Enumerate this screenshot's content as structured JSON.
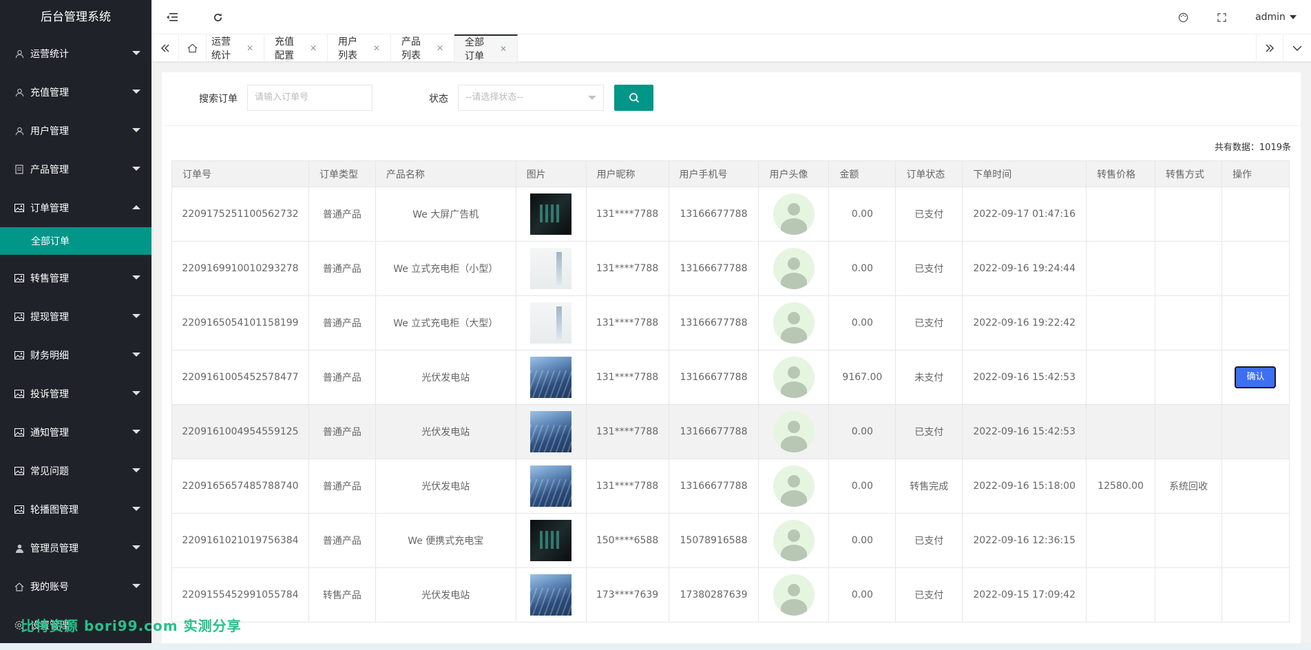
{
  "app": {
    "title": "后台管理系统",
    "user": "admin"
  },
  "sidebar": {
    "items": [
      {
        "label": "运营统计",
        "icon": "user-icon"
      },
      {
        "label": "充值管理",
        "icon": "user-icon"
      },
      {
        "label": "用户管理",
        "icon": "user-icon"
      },
      {
        "label": "产品管理",
        "icon": "doc-icon"
      },
      {
        "label": "订单管理",
        "icon": "image-icon",
        "expanded": true
      },
      {
        "label": "转售管理",
        "icon": "image-icon"
      },
      {
        "label": "提现管理",
        "icon": "image-icon"
      },
      {
        "label": "财务明细",
        "icon": "image-icon"
      },
      {
        "label": "投诉管理",
        "icon": "image-icon"
      },
      {
        "label": "通知管理",
        "icon": "image-icon"
      },
      {
        "label": "常见问题",
        "icon": "image-icon"
      },
      {
        "label": "轮播图管理",
        "icon": "image-icon"
      },
      {
        "label": "管理员管理",
        "icon": "person-icon"
      },
      {
        "label": "我的账号",
        "icon": "home-icon"
      },
      {
        "label": "设置管理",
        "icon": "gear-icon"
      }
    ],
    "sub_active": "全部订单"
  },
  "tabs": [
    {
      "label": "运营统计"
    },
    {
      "label": "充值配置"
    },
    {
      "label": "用户列表"
    },
    {
      "label": "产品列表"
    },
    {
      "label": "全部订单",
      "active": true
    }
  ],
  "search": {
    "order_label": "搜索订单",
    "order_placeholder": "请输入订单号",
    "status_label": "状态",
    "status_placeholder": "--请选择状态--"
  },
  "total": {
    "label": "共有数据：",
    "count": "1019条"
  },
  "table": {
    "headers": [
      "订单号",
      "订单类型",
      "产品名称",
      "图片",
      "用户昵称",
      "用户手机号",
      "用户头像",
      "金额",
      "订单状态",
      "下单时间",
      "转售价格",
      "转售方式",
      "操作"
    ],
    "rows": [
      {
        "order_no": "2209175251100562732",
        "type": "普通产品",
        "product": "We 大屏广告机",
        "image": "dark",
        "nickname": "131****7788",
        "phone": "13166677788",
        "amount": "0.00",
        "status": "已支付",
        "time": "2022-09-17 01:47:16",
        "resale_price": "",
        "resale_method": "",
        "action": ""
      },
      {
        "order_no": "2209169910010293278",
        "type": "普通产品",
        "product": "We 立式充电柜（小型）",
        "image": "light",
        "nickname": "131****7788",
        "phone": "13166677788",
        "amount": "0.00",
        "status": "已支付",
        "time": "2022-09-16 19:24:44",
        "resale_price": "",
        "resale_method": "",
        "action": ""
      },
      {
        "order_no": "2209165054101158199",
        "type": "普通产品",
        "product": "We 立式充电柜（大型）",
        "image": "light",
        "nickname": "131****7788",
        "phone": "13166677788",
        "amount": "0.00",
        "status": "已支付",
        "time": "2022-09-16 19:22:42",
        "resale_price": "",
        "resale_method": "",
        "action": ""
      },
      {
        "order_no": "2209161005452578477",
        "type": "普通产品",
        "product": "光伏发电站",
        "image": "solar",
        "nickname": "131****7788",
        "phone": "13166677788",
        "amount": "9167.00",
        "status": "未支付",
        "time": "2022-09-16 15:42:53",
        "resale_price": "",
        "resale_method": "",
        "action": "确认"
      },
      {
        "order_no": "2209161004954559125",
        "type": "普通产品",
        "product": "光伏发电站",
        "image": "solar",
        "nickname": "131****7788",
        "phone": "13166677788",
        "amount": "0.00",
        "status": "已支付",
        "time": "2022-09-16 15:42:53",
        "resale_price": "",
        "resale_method": "",
        "action": "",
        "highlight": true
      },
      {
        "order_no": "2209165657485788740",
        "type": "普通产品",
        "product": "光伏发电站",
        "image": "solar",
        "nickname": "131****7788",
        "phone": "13166677788",
        "amount": "0.00",
        "status": "转售完成",
        "time": "2022-09-16 15:18:00",
        "resale_price": "12580.00",
        "resale_method": "系统回收",
        "action": ""
      },
      {
        "order_no": "2209161021019756384",
        "type": "普通产品",
        "product": "We 便携式充电宝",
        "image": "dark",
        "nickname": "150****6588",
        "phone": "15078916588",
        "amount": "0.00",
        "status": "已支付",
        "time": "2022-09-16 12:36:15",
        "resale_price": "",
        "resale_method": "",
        "action": ""
      },
      {
        "order_no": "2209155452991055784",
        "type": "转售产品",
        "product": "光伏发电站",
        "image": "solar",
        "nickname": "173****7639",
        "phone": "17380287639",
        "amount": "0.00",
        "status": "已支付",
        "time": "2022-09-15 17:09:42",
        "resale_price": "",
        "resale_method": "",
        "action": ""
      }
    ]
  },
  "watermark": "比特资源 bori99.com 实测分享",
  "colors": {
    "sidebar_bg": "#20222a",
    "accent": "#009688",
    "confirm": "#3d6ff2"
  }
}
